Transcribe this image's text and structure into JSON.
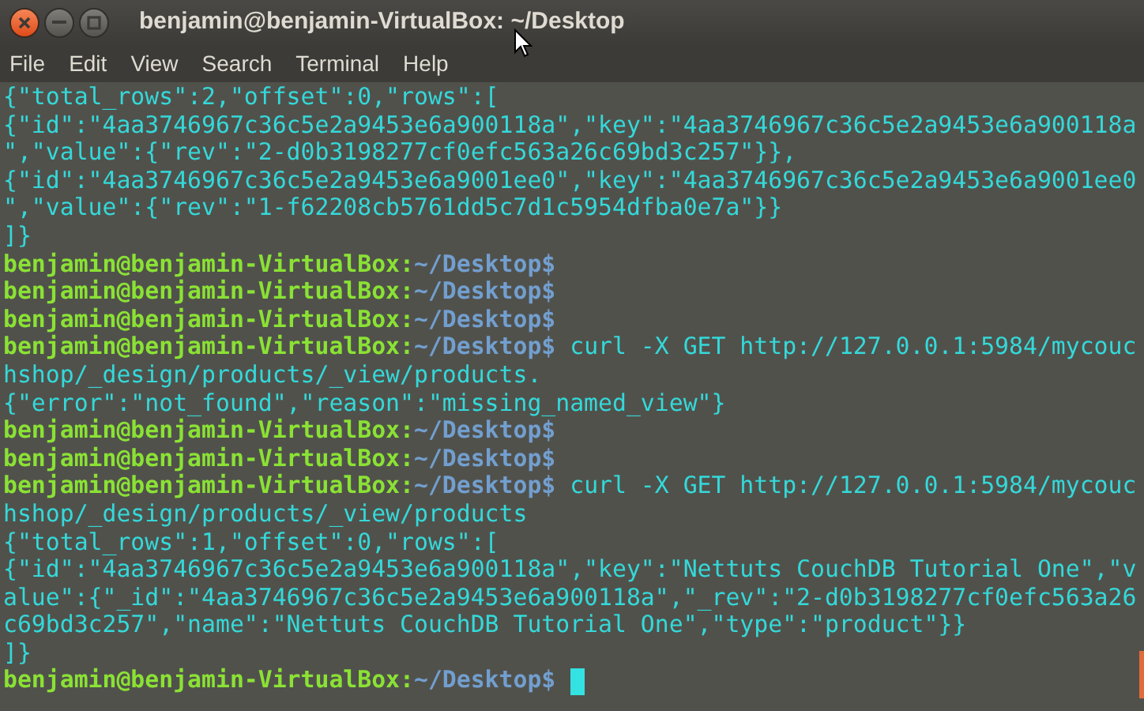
{
  "window": {
    "title": "benjamin@benjamin-VirtualBox: ~/Desktop"
  },
  "menu": [
    "File",
    "Edit",
    "View",
    "Search",
    "Terminal",
    "Help"
  ],
  "lines": [
    {
      "kind": "output",
      "text": "{\"total_rows\":2,\"offset\":0,\"rows\":["
    },
    {
      "kind": "output",
      "text": "{\"id\":\"4aa3746967c36c5e2a9453e6a900118a\",\"key\":\"4aa3746967c36c5e2a9453e6a900118a"
    },
    {
      "kind": "output",
      "text": "\",\"value\":{\"rev\":\"2-d0b3198277cf0efc563a26c69bd3c257\"}},"
    },
    {
      "kind": "output",
      "text": "{\"id\":\"4aa3746967c36c5e2a9453e6a9001ee0\",\"key\":\"4aa3746967c36c5e2a9453e6a9001ee0"
    },
    {
      "kind": "output",
      "text": "\",\"value\":{\"rev\":\"1-f62208cb5761dd5c7d1c5954dfba0e7a\"}}"
    },
    {
      "kind": "output",
      "text": "]}"
    },
    {
      "kind": "prompt",
      "user": "benjamin@benjamin-VirtualBox:",
      "path": "~/Desktop$"
    },
    {
      "kind": "prompt",
      "user": "benjamin@benjamin-VirtualBox:",
      "path": "~/Desktop$"
    },
    {
      "kind": "prompt",
      "user": "benjamin@benjamin-VirtualBox:",
      "path": "~/Desktop$"
    },
    {
      "kind": "prompt",
      "user": "benjamin@benjamin-VirtualBox:",
      "path": "~/Desktop$",
      "command": " curl -X GET http://127.0.0.1:5984/mycouc"
    },
    {
      "kind": "output",
      "text": "hshop/_design/products/_view/products."
    },
    {
      "kind": "output",
      "text": "{\"error\":\"not_found\",\"reason\":\"missing_named_view\"}"
    },
    {
      "kind": "prompt",
      "user": "benjamin@benjamin-VirtualBox:",
      "path": "~/Desktop$"
    },
    {
      "kind": "prompt",
      "user": "benjamin@benjamin-VirtualBox:",
      "path": "~/Desktop$"
    },
    {
      "kind": "prompt",
      "user": "benjamin@benjamin-VirtualBox:",
      "path": "~/Desktop$",
      "command": " curl -X GET http://127.0.0.1:5984/mycouc"
    },
    {
      "kind": "output",
      "text": "hshop/_design/products/_view/products"
    },
    {
      "kind": "output",
      "text": "{\"total_rows\":1,\"offset\":0,\"rows\":["
    },
    {
      "kind": "output",
      "text": "{\"id\":\"4aa3746967c36c5e2a9453e6a900118a\",\"key\":\"Nettuts CouchDB Tutorial One\",\"v"
    },
    {
      "kind": "output",
      "text": "alue\":{\"_id\":\"4aa3746967c36c5e2a9453e6a900118a\",\"_rev\":\"2-d0b3198277cf0efc563a26"
    },
    {
      "kind": "output",
      "text": "c69bd3c257\",\"name\":\"Nettuts CouchDB Tutorial One\",\"type\":\"product\"}}"
    },
    {
      "kind": "output",
      "text": "]}"
    },
    {
      "kind": "prompt",
      "user": "benjamin@benjamin-VirtualBox:",
      "path": "~/Desktop$",
      "cursor": true
    }
  ]
}
